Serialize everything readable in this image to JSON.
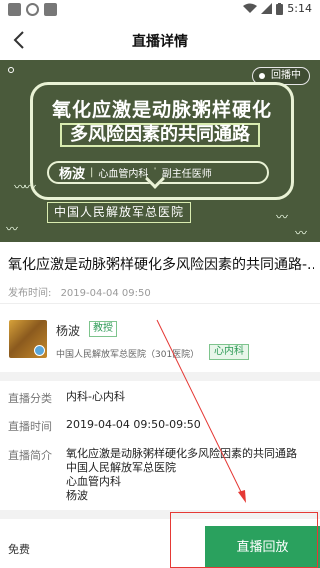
{
  "status_bar": {
    "time": "5:14",
    "icons": [
      "notification-icon",
      "sync-icon",
      "app-icon",
      "wifi-icon",
      "signal-icon",
      "battery-icon"
    ]
  },
  "nav": {
    "title": "直播详情",
    "back_icon": "chevron-left-icon"
  },
  "banner": {
    "badge": "回播中",
    "headline_line1": "氧化应激是动脉粥样硬化",
    "headline_line2": "多风险因素的共同通路",
    "doctor_name": "杨波",
    "doctor_dept": "心血管内科",
    "doctor_rank": "副主任医师",
    "hospital": "中国人民解放军总医院",
    "colors": {
      "background": "#4a5a3b",
      "outline": "#e9f2d5"
    }
  },
  "course": {
    "title": "氧化应激是动脉粥样硬化多风险因素的共同通路-...",
    "publish_label": "发布时间:",
    "publish_time": "2019-04-04 09:50"
  },
  "doctor": {
    "name": "杨波",
    "title_tag": "教授",
    "hospital": "中国人民解放军总医院（301医院）",
    "dept_tag": "心内科"
  },
  "info": {
    "category_label": "直播分类",
    "category_value": "内科-心内科",
    "time_label": "直播时间",
    "time_value": "2019-04-04 09:50-09:50",
    "summary_label": "直播简介",
    "summary_lines": [
      "氧化应激是动脉粥样硬化多风险因素的共同通路",
      "中国人民解放军总医院",
      "心血管内科",
      "杨波"
    ]
  },
  "bottom": {
    "price": "免费",
    "replay_button": "直播回放",
    "accent_color": "#2aa15e"
  },
  "annotation": {
    "color": "#e53935"
  }
}
